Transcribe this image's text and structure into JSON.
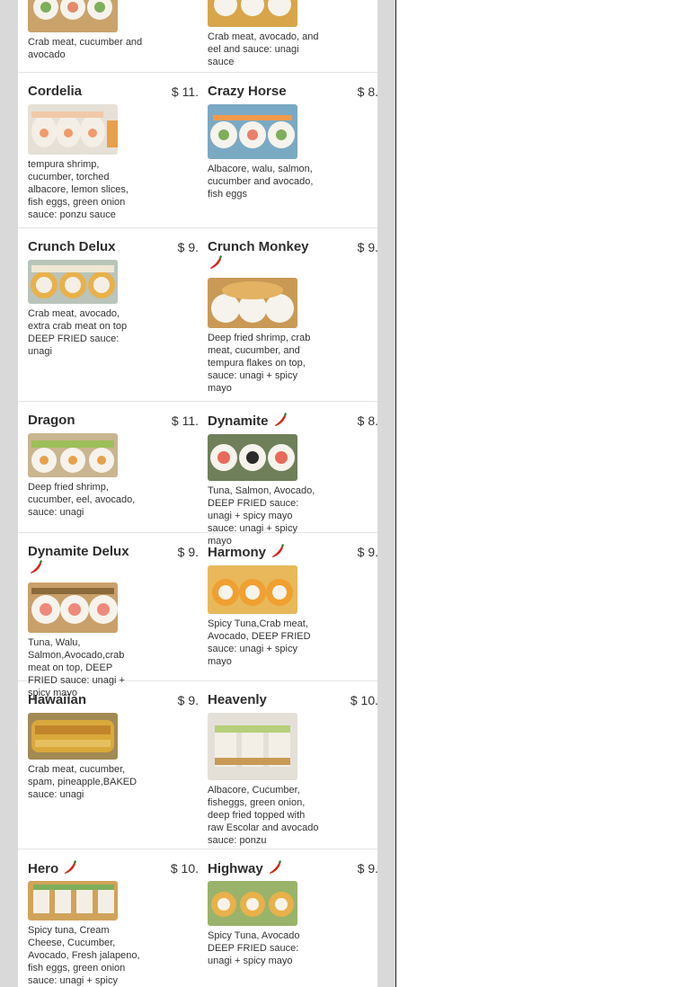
{
  "top_partial": {
    "left": {
      "desc": "Crab meat, cucumber and avocado"
    },
    "right": {
      "desc": "Crab meat, avocado, and eel and sauce: unagi sauce"
    }
  },
  "rows": [
    {
      "left": {
        "name": "Cordelia",
        "price": "$ 11.",
        "spicy": false,
        "desc": "tempura shrimp, cucumber, torched albacore, lemon slices, fish eggs, green onion sauce: ponzu sauce",
        "photo": "roll-photo"
      },
      "right": {
        "name": "Crazy Horse",
        "price": "$ 8.",
        "spicy": false,
        "desc": "Albacore, walu, salmon, cucumber and avocado, fish eggs",
        "photo": "roll-photo"
      }
    },
    {
      "left": {
        "name": "Crunch Delux",
        "price": "$ 9.",
        "spicy": false,
        "desc": "Crab meat, avocado, extra crab meat on top DEEP FRIED sauce: unagi",
        "photo": "roll-photo"
      },
      "right": {
        "name": "Crunch Monkey",
        "price": "$ 9.",
        "spicy": true,
        "desc": "Deep fried shrimp, crab meat, cucumber, and tempura flakes on top, sauce: unagi + spicy mayo",
        "photo": "roll-photo"
      }
    },
    {
      "left": {
        "name": "Dragon",
        "price": "$ 11.",
        "spicy": false,
        "desc": "Deep fried shrimp, cucumber, eel, avocado, sauce: unagi",
        "photo": "roll-photo"
      },
      "right": {
        "name": "Dynamite",
        "price": "$ 8.",
        "spicy": true,
        "desc": "Tuna, Salmon, Avocado, DEEP FRIED sauce: unagi + spicy mayo sauce: unagi + spicy mayo",
        "photo": "roll-photo"
      }
    },
    {
      "left": {
        "name": "Dynamite Delux",
        "price": "$ 9.",
        "spicy": true,
        "desc": "Tuna, Walu, Salmon,Avocado,crab meat on top, DEEP FRIED sauce: unagi + spicy mayo",
        "photo": "roll-photo"
      },
      "right": {
        "name": "Harmony",
        "price": "$ 9.",
        "spicy": true,
        "desc": "Spicy Tuna,Crab meat, Avocado, DEEP FRIED sauce: unagi + spicy mayo",
        "photo": "roll-photo"
      }
    },
    {
      "left": {
        "name": "Hawaiian",
        "price": "$ 9.",
        "spicy": false,
        "desc": "Crab meat, cucumber, spam, pineapple,BAKED sauce: unagi",
        "photo": "roll-photo"
      },
      "right": {
        "name": "Heavenly",
        "price": "$ 10.",
        "spicy": false,
        "desc": "Albacore, Cucumber, fisheggs, green onion, deep fried topped with raw Escolar and avocado sauce: ponzu",
        "photo": "roll-photo"
      }
    },
    {
      "left": {
        "name": "Hero",
        "price": "$ 10.",
        "spicy": true,
        "desc": "Spicy tuna, Cream Cheese, Cucumber, Avocado, Fresh jalapeno, fish eggs, green onion sauce: unagi + spicy mayo and lemon",
        "photo": "roll-photo"
      },
      "right": {
        "name": "Highway",
        "price": "$ 9.",
        "spicy": true,
        "desc": "Spicy Tuna, Avocado DEEP FRIED sauce: unagi + spicy mayo",
        "photo": "roll-photo"
      }
    }
  ],
  "icons": {
    "spicy": "chili-pepper-icon"
  },
  "colors": {
    "gutter": "#d9d9d9",
    "pepper_red": "#d2261c",
    "pepper_stem": "#2e7d32"
  }
}
